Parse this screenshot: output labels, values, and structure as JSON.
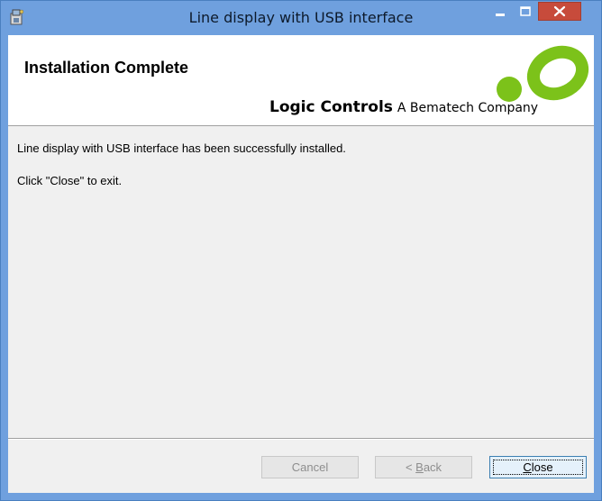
{
  "window": {
    "title": "Line display with USB interface"
  },
  "titlebar": {
    "app_icon": "installer-icon",
    "controls": [
      "minimize-icon",
      "maximize-icon",
      "close-icon"
    ],
    "close_color": "#c74b3b"
  },
  "banner": {
    "title": "Installation Complete",
    "brand_name": "Logic Controls",
    "brand_tagline": "A Bematech Company",
    "logo_colors": {
      "dot": "#7cc21a",
      "ring": "#7cc21a"
    }
  },
  "body": {
    "message": "Line display with USB interface has been successfully installed.",
    "instruction": "Click \"Close\" to exit."
  },
  "buttons": {
    "cancel": {
      "label": "Cancel",
      "enabled": false
    },
    "back": {
      "prefix": "< ",
      "underline": "B",
      "rest": "ack",
      "enabled": false
    },
    "close": {
      "underline": "C",
      "rest": "lose",
      "enabled": true
    }
  }
}
